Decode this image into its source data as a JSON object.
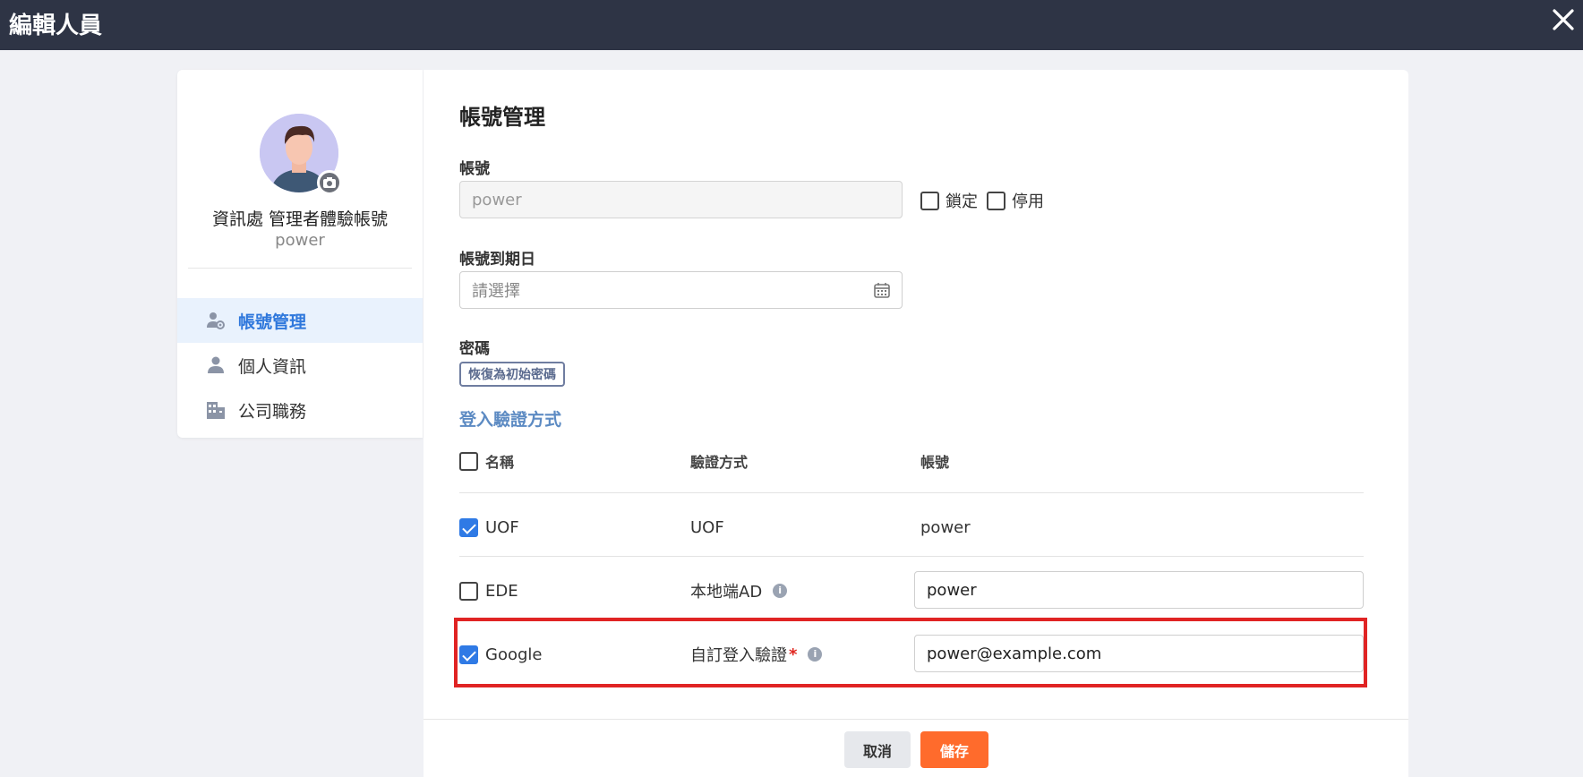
{
  "window": {
    "title": "編輯人員",
    "close_icon": "close-icon"
  },
  "profile": {
    "display_name": "資訊處 管理者體驗帳號",
    "account": "power",
    "avatar_icon": "avatar-illustration",
    "camera_icon": "camera-icon"
  },
  "sidebar": {
    "items": [
      {
        "label": "帳號管理",
        "icon": "user-gear-icon",
        "active": true
      },
      {
        "label": "個人資訊",
        "icon": "user-icon",
        "active": false
      },
      {
        "label": "公司職務",
        "icon": "building-icon",
        "active": false
      }
    ]
  },
  "account_section": {
    "title": "帳號管理",
    "account_label": "帳號",
    "account_value": "power",
    "lock_label": "鎖定",
    "lock_checked": false,
    "disable_label": "停用",
    "disable_checked": false,
    "expiry_label": "帳號到期日",
    "expiry_placeholder": "請選擇",
    "password_label": "密碼",
    "reset_password_button": "恢復為初始密碼"
  },
  "login_auth": {
    "title": "登入驗證方式",
    "columns": [
      "名稱",
      "驗證方式",
      "帳號"
    ],
    "rows": [
      {
        "name": "UOF",
        "checked": true,
        "method": "UOF",
        "account": "power",
        "editable": false,
        "required": false,
        "info": false
      },
      {
        "name": "EDE",
        "checked": false,
        "method": "本地端AD",
        "account": "power",
        "editable": true,
        "required": false,
        "info": true
      },
      {
        "name": "Google",
        "checked": true,
        "method": "自訂登入驗證",
        "account": "power@example.com",
        "editable": true,
        "required": true,
        "info": true
      }
    ],
    "required_mark": "*",
    "info_glyph": "i"
  },
  "footer": {
    "cancel_label": "取消",
    "save_label": "儲存"
  },
  "colors": {
    "topbar": "#2e3445",
    "accent_blue": "#2f7ae5",
    "save_orange": "#ff6b2c",
    "highlight_red": "#e02424",
    "section_blue": "#5d8bc3"
  }
}
